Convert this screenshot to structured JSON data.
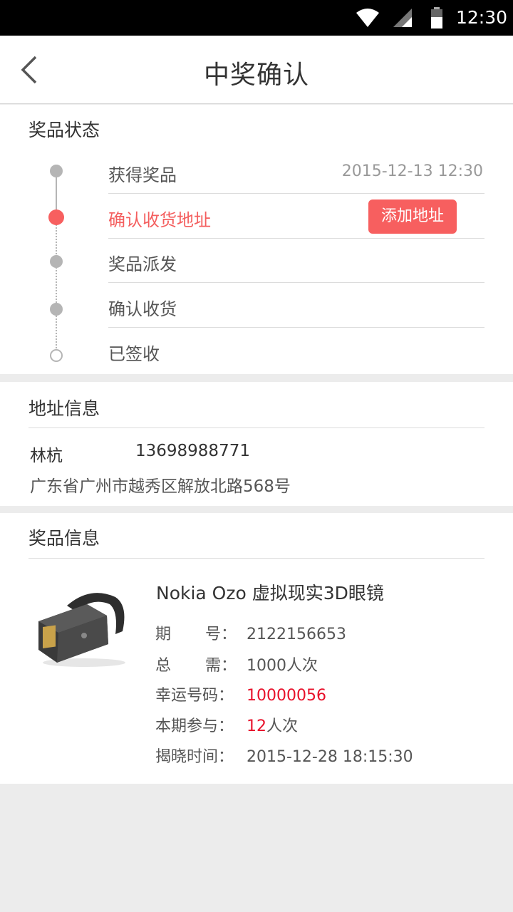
{
  "status_bar": {
    "time": "12:30"
  },
  "header": {
    "title": "中奖确认"
  },
  "prize_status": {
    "title": "奖品状态",
    "steps": [
      {
        "label": "获得奖品",
        "time": "2015-12-13 12:30"
      },
      {
        "label": "确认收货地址",
        "action": "添加地址"
      },
      {
        "label": "奖品派发"
      },
      {
        "label": "确认收货"
      },
      {
        "label": "已签收"
      }
    ]
  },
  "address": {
    "title": "地址信息",
    "name": "林杭",
    "phone": "13698988771",
    "detail": "广东省广州市越秀区解放北路568号"
  },
  "prize": {
    "title": "奖品信息",
    "name": "Nokia Ozo 虚拟现实3D眼镜",
    "period_label_1": "期",
    "period_label_2": "号：",
    "period": "2122156653",
    "total_label_1": "总",
    "total_label_2": "需：",
    "total": "1000人次",
    "lucky_label": "幸运号码：",
    "lucky": "10000056",
    "join_label": "本期参与：",
    "join_count": "12",
    "join_unit": "人次",
    "reveal_label": "揭晓时间：",
    "reveal_time": "2015-12-28 18:15:30"
  },
  "colors": {
    "accent": "#f75f5f",
    "lucky_red": "#e8102a"
  }
}
